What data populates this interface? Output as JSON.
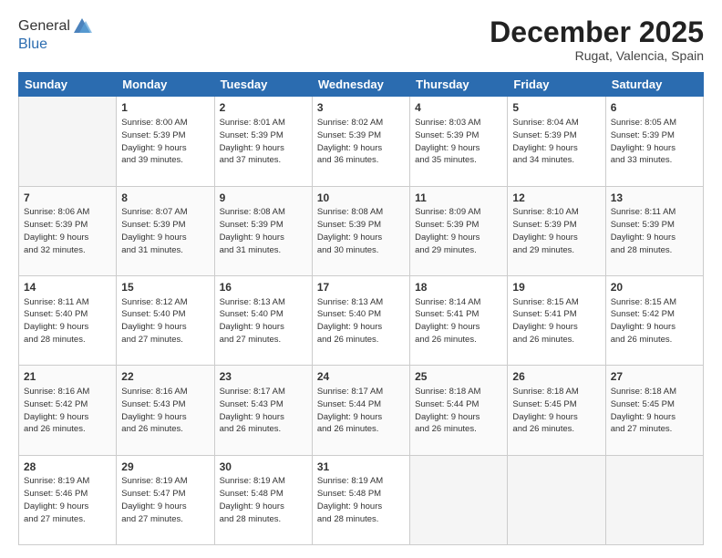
{
  "header": {
    "logo_line1": "General",
    "logo_line2": "Blue",
    "month_title": "December 2025",
    "subtitle": "Rugat, Valencia, Spain"
  },
  "days_of_week": [
    "Sunday",
    "Monday",
    "Tuesday",
    "Wednesday",
    "Thursday",
    "Friday",
    "Saturday"
  ],
  "weeks": [
    [
      {
        "day": "",
        "info": "",
        "empty": true
      },
      {
        "day": "1",
        "info": "Sunrise: 8:00 AM\nSunset: 5:39 PM\nDaylight: 9 hours\nand 39 minutes."
      },
      {
        "day": "2",
        "info": "Sunrise: 8:01 AM\nSunset: 5:39 PM\nDaylight: 9 hours\nand 37 minutes."
      },
      {
        "day": "3",
        "info": "Sunrise: 8:02 AM\nSunset: 5:39 PM\nDaylight: 9 hours\nand 36 minutes."
      },
      {
        "day": "4",
        "info": "Sunrise: 8:03 AM\nSunset: 5:39 PM\nDaylight: 9 hours\nand 35 minutes."
      },
      {
        "day": "5",
        "info": "Sunrise: 8:04 AM\nSunset: 5:39 PM\nDaylight: 9 hours\nand 34 minutes."
      },
      {
        "day": "6",
        "info": "Sunrise: 8:05 AM\nSunset: 5:39 PM\nDaylight: 9 hours\nand 33 minutes."
      }
    ],
    [
      {
        "day": "7",
        "info": "Sunrise: 8:06 AM\nSunset: 5:39 PM\nDaylight: 9 hours\nand 32 minutes."
      },
      {
        "day": "8",
        "info": "Sunrise: 8:07 AM\nSunset: 5:39 PM\nDaylight: 9 hours\nand 31 minutes."
      },
      {
        "day": "9",
        "info": "Sunrise: 8:08 AM\nSunset: 5:39 PM\nDaylight: 9 hours\nand 31 minutes."
      },
      {
        "day": "10",
        "info": "Sunrise: 8:08 AM\nSunset: 5:39 PM\nDaylight: 9 hours\nand 30 minutes."
      },
      {
        "day": "11",
        "info": "Sunrise: 8:09 AM\nSunset: 5:39 PM\nDaylight: 9 hours\nand 29 minutes."
      },
      {
        "day": "12",
        "info": "Sunrise: 8:10 AM\nSunset: 5:39 PM\nDaylight: 9 hours\nand 29 minutes."
      },
      {
        "day": "13",
        "info": "Sunrise: 8:11 AM\nSunset: 5:39 PM\nDaylight: 9 hours\nand 28 minutes."
      }
    ],
    [
      {
        "day": "14",
        "info": "Sunrise: 8:11 AM\nSunset: 5:40 PM\nDaylight: 9 hours\nand 28 minutes."
      },
      {
        "day": "15",
        "info": "Sunrise: 8:12 AM\nSunset: 5:40 PM\nDaylight: 9 hours\nand 27 minutes."
      },
      {
        "day": "16",
        "info": "Sunrise: 8:13 AM\nSunset: 5:40 PM\nDaylight: 9 hours\nand 27 minutes."
      },
      {
        "day": "17",
        "info": "Sunrise: 8:13 AM\nSunset: 5:40 PM\nDaylight: 9 hours\nand 26 minutes."
      },
      {
        "day": "18",
        "info": "Sunrise: 8:14 AM\nSunset: 5:41 PM\nDaylight: 9 hours\nand 26 minutes."
      },
      {
        "day": "19",
        "info": "Sunrise: 8:15 AM\nSunset: 5:41 PM\nDaylight: 9 hours\nand 26 minutes."
      },
      {
        "day": "20",
        "info": "Sunrise: 8:15 AM\nSunset: 5:42 PM\nDaylight: 9 hours\nand 26 minutes."
      }
    ],
    [
      {
        "day": "21",
        "info": "Sunrise: 8:16 AM\nSunset: 5:42 PM\nDaylight: 9 hours\nand 26 minutes."
      },
      {
        "day": "22",
        "info": "Sunrise: 8:16 AM\nSunset: 5:43 PM\nDaylight: 9 hours\nand 26 minutes."
      },
      {
        "day": "23",
        "info": "Sunrise: 8:17 AM\nSunset: 5:43 PM\nDaylight: 9 hours\nand 26 minutes."
      },
      {
        "day": "24",
        "info": "Sunrise: 8:17 AM\nSunset: 5:44 PM\nDaylight: 9 hours\nand 26 minutes."
      },
      {
        "day": "25",
        "info": "Sunrise: 8:18 AM\nSunset: 5:44 PM\nDaylight: 9 hours\nand 26 minutes."
      },
      {
        "day": "26",
        "info": "Sunrise: 8:18 AM\nSunset: 5:45 PM\nDaylight: 9 hours\nand 26 minutes."
      },
      {
        "day": "27",
        "info": "Sunrise: 8:18 AM\nSunset: 5:45 PM\nDaylight: 9 hours\nand 27 minutes."
      }
    ],
    [
      {
        "day": "28",
        "info": "Sunrise: 8:19 AM\nSunset: 5:46 PM\nDaylight: 9 hours\nand 27 minutes."
      },
      {
        "day": "29",
        "info": "Sunrise: 8:19 AM\nSunset: 5:47 PM\nDaylight: 9 hours\nand 27 minutes."
      },
      {
        "day": "30",
        "info": "Sunrise: 8:19 AM\nSunset: 5:48 PM\nDaylight: 9 hours\nand 28 minutes."
      },
      {
        "day": "31",
        "info": "Sunrise: 8:19 AM\nSunset: 5:48 PM\nDaylight: 9 hours\nand 28 minutes."
      },
      {
        "day": "",
        "info": "",
        "empty": true
      },
      {
        "day": "",
        "info": "",
        "empty": true
      },
      {
        "day": "",
        "info": "",
        "empty": true
      }
    ]
  ]
}
